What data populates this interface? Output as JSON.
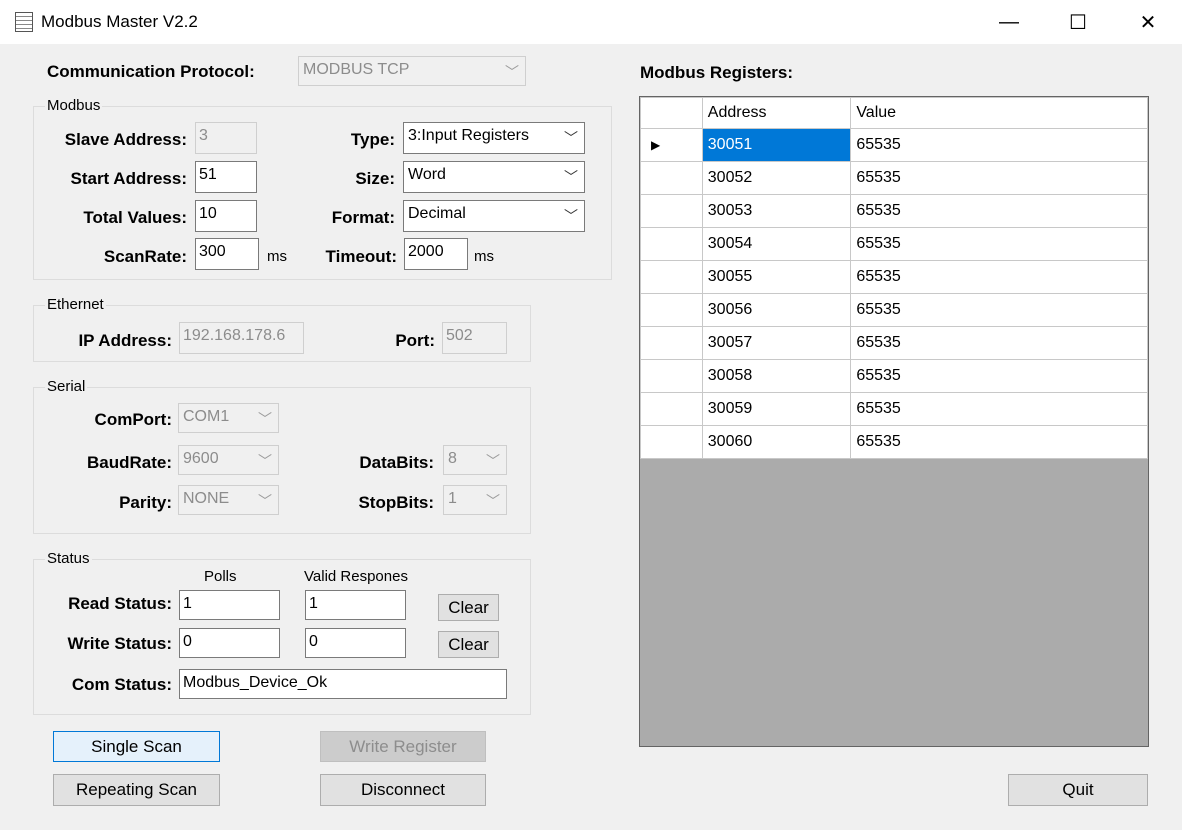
{
  "window": {
    "title": "Modbus Master V2.2",
    "minimize": "—",
    "maximize": "☐",
    "close": "✕"
  },
  "protocol": {
    "label": "Communication Protocol:",
    "value": "MODBUS TCP"
  },
  "modbus": {
    "group": "Modbus",
    "slave_label": "Slave Address:",
    "slave_value": "3",
    "start_label": "Start Address:",
    "start_value": "51",
    "total_label": "Total Values:",
    "total_value": "10",
    "scan_label": "ScanRate:",
    "scan_value": "300",
    "scan_unit": "ms",
    "type_label": "Type:",
    "type_value": "3:Input Registers",
    "size_label": "Size:",
    "size_value": "Word",
    "format_label": "Format:",
    "format_value": "Decimal",
    "timeout_label": "Timeout:",
    "timeout_value": "2000",
    "timeout_unit": "ms"
  },
  "ethernet": {
    "group": "Ethernet",
    "ip_label": "IP Address:",
    "ip_value": "192.168.178.6",
    "port_label": "Port:",
    "port_value": "502"
  },
  "serial": {
    "group": "Serial",
    "comport_label": "ComPort:",
    "comport_value": "COM1",
    "baud_label": "BaudRate:",
    "baud_value": "9600",
    "parity_label": "Parity:",
    "parity_value": "NONE",
    "databits_label": "DataBits:",
    "databits_value": "8",
    "stopbits_label": "StopBits:",
    "stopbits_value": "1"
  },
  "status": {
    "group": "Status",
    "polls_header": "Polls",
    "valid_header": "Valid Respones",
    "read_label": "Read Status:",
    "read_polls": "1",
    "read_valid": "1",
    "write_label": "Write Status:",
    "write_polls": "0",
    "write_valid": "0",
    "clear": "Clear",
    "com_label": "Com Status:",
    "com_value": "Modbus_Device_Ok"
  },
  "buttons": {
    "single_scan": "Single Scan",
    "write_register": "Write Register",
    "repeating_scan": "Repeating Scan",
    "disconnect": "Disconnect",
    "quit": "Quit"
  },
  "registers": {
    "title": "Modbus Registers:",
    "col_address": "Address",
    "col_value": "Value",
    "current_row_marker": "▶",
    "rows": [
      {
        "address": "30051",
        "value": "65535"
      },
      {
        "address": "30052",
        "value": "65535"
      },
      {
        "address": "30053",
        "value": "65535"
      },
      {
        "address": "30054",
        "value": "65535"
      },
      {
        "address": "30055",
        "value": "65535"
      },
      {
        "address": "30056",
        "value": "65535"
      },
      {
        "address": "30057",
        "value": "65535"
      },
      {
        "address": "30058",
        "value": "65535"
      },
      {
        "address": "30059",
        "value": "65535"
      },
      {
        "address": "30060",
        "value": "65535"
      }
    ]
  }
}
